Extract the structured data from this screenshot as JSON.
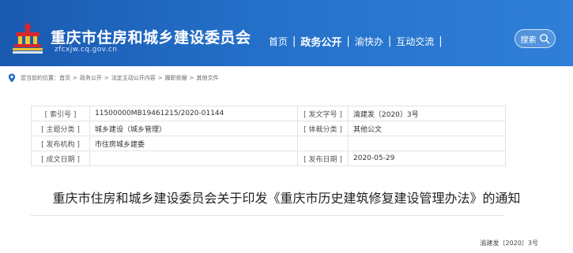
{
  "header": {
    "site_title": "重庆市住房和城乡建设委员会",
    "site_domain": "zfcxjw.cq.gov.cn",
    "nav": [
      {
        "label": "首页",
        "active": false
      },
      {
        "label": "政务公开",
        "active": true
      },
      {
        "label": "渝快办",
        "active": false
      },
      {
        "label": "互动交流",
        "active": false
      }
    ],
    "search_label": "搜索"
  },
  "breadcrumb": {
    "prefix": "您当前的位置：",
    "items": [
      "首页",
      "政务公开",
      "法定主动公开内容",
      "履职依据",
      "其他文件"
    ],
    "separator": ">"
  },
  "info_table": {
    "rows": [
      {
        "k1": "[ 索引号 ]",
        "v1": "11500000MB19461215/2020-01144",
        "k2": "[ 发文字号 ]",
        "v2": "渝建发〔2020〕3号"
      },
      {
        "k1": "[ 主题分类 ]",
        "v1": "城乡建设（城乡管理）",
        "k2": "[ 体裁分类 ]",
        "v2": "其他公文"
      },
      {
        "k1": "[ 发布机构 ]",
        "v1": "市住房城乡建委",
        "k2": "",
        "v2": ""
      },
      {
        "k1": "[ 成文日期 ]",
        "v1": "",
        "k2": "[ 发布日期 ]",
        "v2": "2020-05-29"
      }
    ]
  },
  "document": {
    "title": "重庆市住房和城乡建设委员会关于印发《重庆市历史建筑修复建设管理办法》的通知",
    "number": "渝建发〔2020〕3号"
  },
  "colors": {
    "header_blue": "#2470c9",
    "logo_red": "#d7262c",
    "logo_yellow": "#f4c32e"
  }
}
